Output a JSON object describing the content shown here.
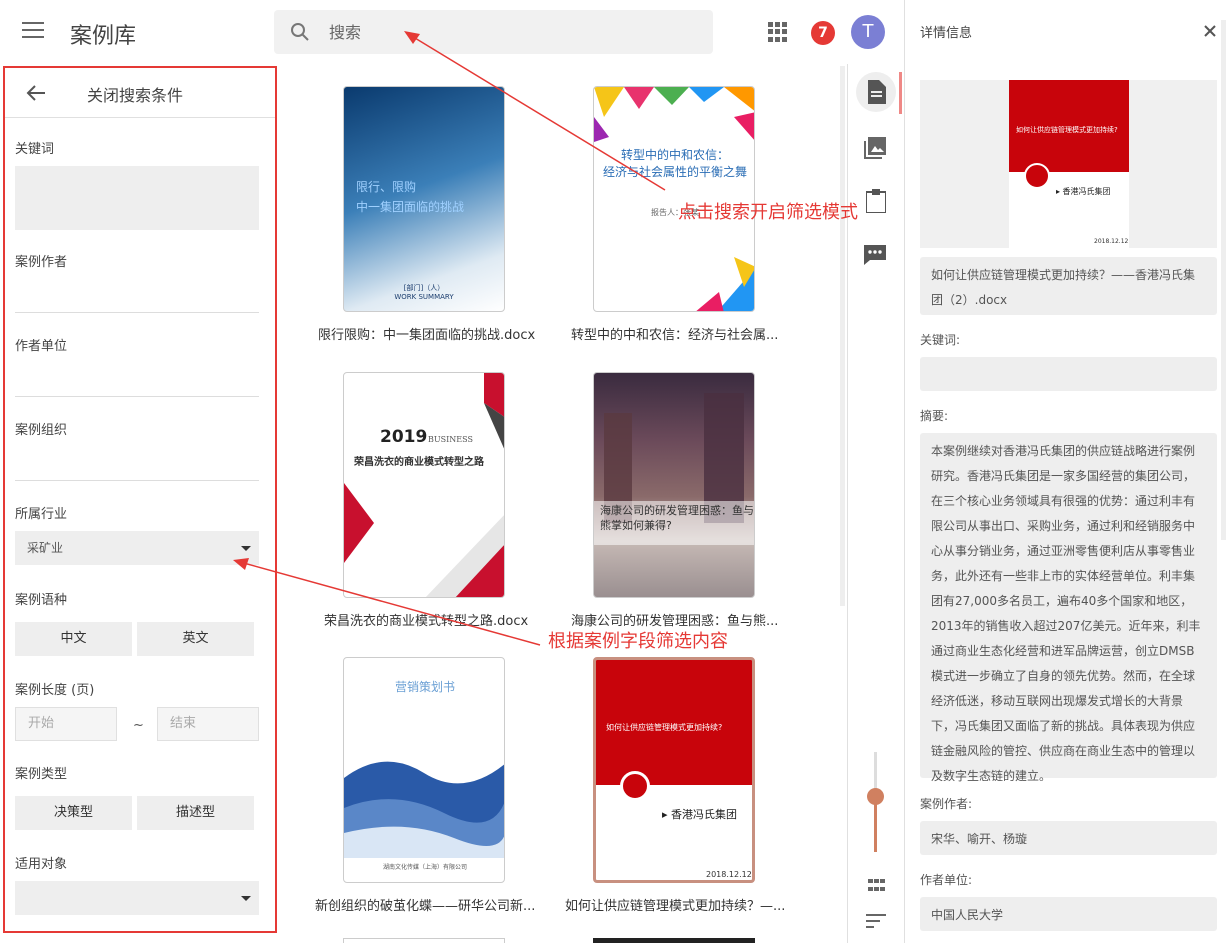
{
  "app": {
    "title": "案例库"
  },
  "search": {
    "placeholder": "搜索"
  },
  "header": {
    "notification_count": "7",
    "avatar_initial": "T"
  },
  "filter_panel": {
    "title": "关闭搜索条件",
    "keyword_label": "关键词",
    "author_label": "案例作者",
    "author_unit_label": "作者单位",
    "organization_label": "案例组织",
    "industry_label": "所属行业",
    "industry_selected": "采矿业",
    "language_label": "案例语种",
    "language_options": [
      "中文",
      "英文"
    ],
    "length_label": "案例长度 (页)",
    "length_start_placeholder": "开始",
    "length_end_placeholder": "结束",
    "length_separator": "~",
    "type_label": "案例类型",
    "type_options": [
      "决策型",
      "描述型"
    ],
    "audience_label": "适用对象"
  },
  "cards": [
    {
      "title": "限行限购：中一集团面临的挑战.docx",
      "cover_text": [
        "限行、限购",
        "中一集团面临的挑战"
      ],
      "cover_sub": "[部门]（人）",
      "cover_sub2": "WORK SUMMARY"
    },
    {
      "title": "转型中的中和农信：经济与社会属...",
      "cover_text": [
        "转型中的中和农信：",
        "经济与社会属性的平衡之舞"
      ],
      "cover_sub": "报告人：张某"
    },
    {
      "title": "荣昌洗衣的商业模式转型之路.docx",
      "cover_text": [
        "2019",
        "BUSINESS",
        "荣昌洗衣的商业模式转型之路"
      ]
    },
    {
      "title": "海康公司的研发管理困惑：鱼与熊...",
      "cover_text": [
        "海康公司的研发管理困惑：鱼与",
        "熊掌如何兼得?"
      ]
    },
    {
      "title": "新创组织的破茧化蝶——研华公司新...",
      "cover_text": [
        "营销策划书"
      ],
      "cover_sub": "湖南文化传媒（上海）有限公司"
    },
    {
      "title": "如何让供应链管理模式更加持续？—...",
      "cover_text": [
        "如何让供应链管理模式更加持续?",
        "▸ 香港冯氏集团",
        "2018.12.12"
      ]
    }
  ],
  "details": {
    "title": "详情信息",
    "preview_text": [
      "如何让供应链管理模式更加持续?",
      "▸ 香港冯氏集团",
      "2018.12.12"
    ],
    "filename": "如何让供应链管理模式更加持续？——香港冯氏集团（2）.docx",
    "keywords_label": "关键词:",
    "keywords_value": "",
    "abstract_label": "摘要:",
    "abstract": "本案例继续对香港冯氏集团的供应链战略进行案例研究。香港冯氏集团是一家多国经营的集团公司，在三个核心业务领域具有很强的优势：通过利丰有限公司从事出口、采购业务，通过利和经销服务中心从事分销业务，通过亚洲零售便利店从事零售业务，此外还有一些非上市的实体经营单位。利丰集团有27,000多名员工，遍布40多个国家和地区，2013年的销售收入超过207亿美元。近年来，利丰通过商业生态化经营和进军品牌运营，创立DMSB模式进一步确立了自身的领先优势。然而，在全球经济低迷，移动互联网出现爆发式增长的大背景下，冯氏集团又面临了新的挑战。具体表现为供应链金融风险的管控、供应商在商业生态中的管理以及数字生态链的建立。",
    "author_label": "案例作者:",
    "author_value": "宋华、喻开、杨璇",
    "unit_label": "作者单位:",
    "unit_value": "中国人民大学"
  },
  "annotations": {
    "search_hint": "点击搜索开启筛选模式",
    "filter_hint": "根据案例字段筛选内容"
  },
  "colors": {
    "accent_red": "#e53935",
    "brand_red": "#c8040b",
    "avatar": "#7b7fd4"
  }
}
